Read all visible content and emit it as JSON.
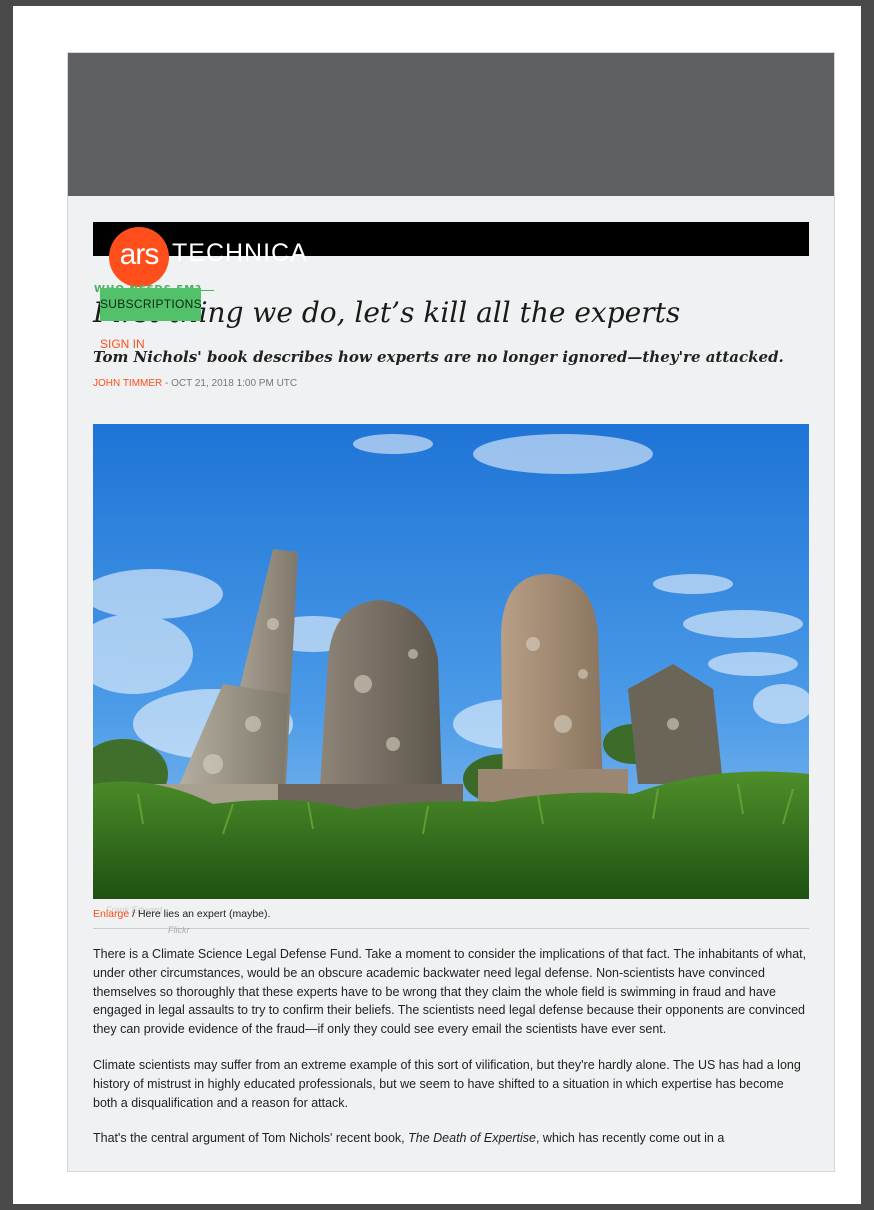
{
  "header": {
    "logo_mark": "ars",
    "logo_word": "TECHNICA",
    "subscriptions_label": "SUBSCRIPTIONS",
    "sign_in_label": "SIGN IN"
  },
  "article": {
    "kicker": "WHO NEEDS EM?",
    "title": "First thing we do, let’s kill all the experts",
    "subtitle": "Tom Nichols' book describes how experts are no longer ignored—they're attacked.",
    "author": "JOHN TIMMER",
    "separator": " - ",
    "date": "OCT 21, 2018 1:00 PM UTC"
  },
  "image": {
    "enlarge_label": "Enlarge",
    "caption_sep": " / ",
    "caption": "Here lies an expert (maybe).",
    "credit": "Flickr",
    "credit_ghost": "Frank  Edward"
  },
  "body": {
    "p1": "There is a Climate Science Legal Defense Fund. Take a moment to consider the implications of that fact. The inhabitants of what, under other circumstances, would be an obscure academic backwater need legal defense. Non-scientists have convinced themselves so thoroughly that these experts have to be wrong that they claim the whole field is swimming in fraud and have engaged in legal assaults to try to confirm their beliefs. The scientists need legal defense because their opponents are convinced they can provide evidence of the fraud—if only they could see every email the scientists have ever sent.",
    "p2": "Climate scientists may suffer from an extreme example of this sort of vilification, but they're hardly alone. The US has had a long history of mistrust in highly educated professionals, but we seem to have shifted to a situation in which expertise has become both a disqualification and a reason for attack.",
    "p3_start": "That's the central argument of Tom Nichols' recent book, ",
    "p3_book": "The Death of Expertise",
    "p3_end": ", which has recently come out in a"
  },
  "colors": {
    "brand": "#ff4e1b",
    "subscribe": "#53c06a",
    "kicker": "#48b35a"
  }
}
